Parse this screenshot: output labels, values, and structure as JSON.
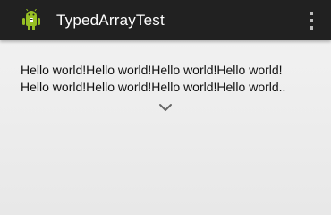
{
  "app": {
    "title": "TypedArrayTest",
    "icon": "android-robot-icon"
  },
  "toolbar": {
    "overflow_icon": "overflow-menu-icon"
  },
  "content": {
    "line1": "Hello world!Hello world!Hello world!Hello world!",
    "line2": "Hello world!Hello world!Hello world!Hello world..",
    "expand_icon": "chevron-down-icon"
  },
  "colors": {
    "action_bar": "#212121",
    "android_green": "#97c024",
    "text": "#111111",
    "background": "#f0f0f0"
  }
}
